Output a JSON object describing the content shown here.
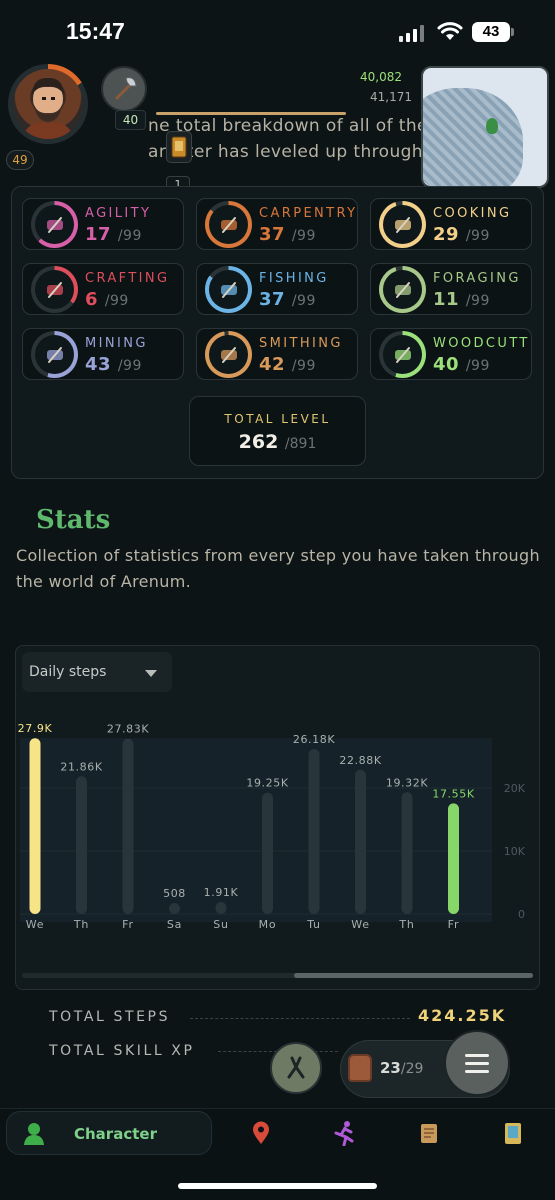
{
  "status_bar": {
    "time": "15:47",
    "battery": "43"
  },
  "header": {
    "tool_level": "40",
    "player_level": "49",
    "xp_current": "40,082",
    "xp_next": "41,171",
    "card_count": "1",
    "background_text_line1": "ne total breakdown of all of the skill",
    "background_text_line2": "aracter has leveled up throughout your jo"
  },
  "skills": [
    {
      "name": "AGILITY",
      "level": "17",
      "max": "/99",
      "color": "#d65fa8",
      "progress": 0.62
    },
    {
      "name": "CARPENTRY",
      "level": "37",
      "max": "/99",
      "color": "#d8773a",
      "progress": 0.86
    },
    {
      "name": "COOKING",
      "level": "29",
      "max": "/99",
      "color": "#f2d08a",
      "progress": 0.95
    },
    {
      "name": "CRAFTING",
      "level": "6",
      "max": "/99",
      "color": "#de4e5c",
      "progress": 0.35
    },
    {
      "name": "FISHING",
      "level": "37",
      "max": "/99",
      "color": "#6db4e6",
      "progress": 0.85
    },
    {
      "name": "FORAGING",
      "level": "11",
      "max": "/99",
      "color": "#a8c88a",
      "progress": 0.95
    },
    {
      "name": "MINING",
      "level": "43",
      "max": "/99",
      "color": "#9aa3d8",
      "progress": 0.55
    },
    {
      "name": "SMITHING",
      "level": "42",
      "max": "/99",
      "color": "#d89a5a",
      "progress": 0.97
    },
    {
      "name": "WOODCUTTING",
      "level": "40",
      "max": "/99",
      "color": "#9be07a",
      "progress": 0.55
    }
  ],
  "total_level": {
    "label": "TOTAL LEVEL",
    "value": "262",
    "max": "/891"
  },
  "stats": {
    "title": "Stats",
    "description": "Collection of statistics from every step you have taken through the world of Arenum."
  },
  "chart_data": {
    "type": "bar",
    "title": "",
    "selector": "Daily steps",
    "categories": [
      "We",
      "Th",
      "Fr",
      "Sa",
      "Su",
      "Mo",
      "Tu",
      "We",
      "Th",
      "Fr"
    ],
    "values": [
      27900,
      21860,
      27830,
      508,
      1910,
      19250,
      26180,
      22880,
      19320,
      17550
    ],
    "data_labels": [
      "27.9K",
      "21.86K",
      "27.83K",
      "508",
      "1.91K",
      "19.25K",
      "26.18K",
      "22.88K",
      "19.32K",
      "17.55K"
    ],
    "highlight": [
      0,
      9
    ],
    "highlight_colors": [
      "#f6e487",
      "#86d66a"
    ],
    "bar_color": "#28363b",
    "y_ticks": [
      "0",
      "10K",
      "20K"
    ],
    "ylim": [
      0,
      30000
    ],
    "grid": true
  },
  "totals": {
    "steps_label": "TOTAL STEPS",
    "steps_value": "424.25K",
    "xp_label": "TOTAL SKILL XP"
  },
  "bag": {
    "count": "23",
    "max": "/29"
  },
  "nav": {
    "character_label": "Character"
  },
  "icons": {
    "nav": [
      "character-icon",
      "map-pin-icon",
      "runner-icon",
      "scroll-icon",
      "card-icon"
    ],
    "fabs": [
      "pliers-icon",
      "backpack-icon",
      "hamburger-menu-icon"
    ]
  }
}
